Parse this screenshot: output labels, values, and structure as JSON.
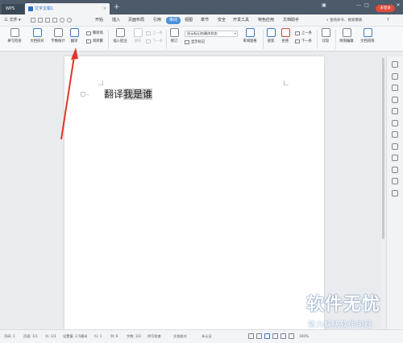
{
  "titlebar": {
    "app_tab": "WPS",
    "doc_tab": "文字文稿1",
    "new_tab": "+",
    "login_button": "未登录",
    "minimize": "—",
    "maximize": "□",
    "close": "✕"
  },
  "menubar": {
    "file": "三 文件 ▾",
    "items": [
      "开始",
      "插入",
      "页面布局",
      "引用",
      "审阅",
      "视图",
      "章节",
      "安全",
      "开发工具",
      "特色应用",
      "文档助手"
    ],
    "active_index": 4,
    "search": "查找命令、搜索模板"
  },
  "ribbon": {
    "spell_check": "拼写检查",
    "doc_check": "文档校对",
    "word_count": "字数统计",
    "translate": "翻译",
    "simplified": "繁转简",
    "traditional": "简转繁",
    "insert_comment": "插入批注",
    "delete": "删除",
    "prev": "上一条",
    "next": "下一条",
    "track": "修订",
    "track_select": "显示标记的最终状态",
    "show_markup": "显示标记",
    "reviewing_pane": "审阅窗格",
    "accept": "接受",
    "reject": "拒绝",
    "prev_change": "上一条",
    "next_change": "下一条",
    "compare": "比较",
    "restrict_edit": "限制编辑",
    "doc_permission": "文档权限"
  },
  "document": {
    "text_plain": "翻译",
    "text_selected": "我是谁"
  },
  "statusbar": {
    "page_num": "页码: 1",
    "pages": "页面: 1/1",
    "section": "节: 1/1",
    "setting": "设置值: 2.5厘米",
    "row": "行: 1",
    "col": "列: 6",
    "words": "字数: 3/3",
    "spell": "拼写检查",
    "doc_check": "文档校对",
    "unverified": "未认证",
    "zoom": "100%"
  },
  "watermark": {
    "title": "软件无忧",
    "subtitle": "努力解决软件问题"
  },
  "colors": {
    "titlebar": "#4c5a6a",
    "accent": "#4a90d9",
    "arrow": "#e0352b",
    "login": "#e24a3b"
  }
}
